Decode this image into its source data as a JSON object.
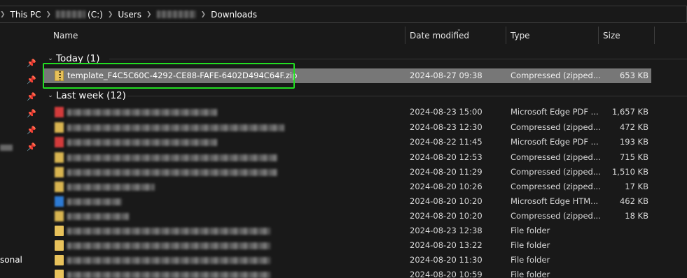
{
  "breadcrumb": {
    "items": [
      {
        "label": "This PC",
        "blurred": false
      },
      {
        "label": "(C:)",
        "blurred": true
      },
      {
        "label": "Users",
        "blurred": false
      },
      {
        "label": "",
        "blurred": true
      },
      {
        "label": "Downloads",
        "blurred": false
      }
    ]
  },
  "sidebar": {
    "partial_label": "sonal"
  },
  "columns": {
    "name": "Name",
    "date": "Date modified",
    "type": "Type",
    "size": "Size"
  },
  "groups": [
    {
      "label": "Today (1)",
      "rows": [
        {
          "name": "template_F4C5C60C-4292-CE88-FAFE-6402D494C64F.zip",
          "date": "2024-08-27 09:38",
          "type": "Compressed (zipped...",
          "size": "653 KB",
          "icon": "zip-icon",
          "selected": true,
          "blurred": false
        }
      ]
    },
    {
      "label": "Last week (12)",
      "rows": [
        {
          "name": "",
          "date": "2024-08-23 15:00",
          "type": "Microsoft Edge PDF ...",
          "size": "1,657 KB",
          "icon": "pdf-icon",
          "blurred": true
        },
        {
          "name": "",
          "date": "2024-08-23 12:30",
          "type": "Compressed (zipped...",
          "size": "472 KB",
          "icon": "zip-icon",
          "blurred": true
        },
        {
          "name": "",
          "date": "2024-08-22 11:45",
          "type": "Microsoft Edge PDF ...",
          "size": "193 KB",
          "icon": "pdf-icon",
          "blurred": true
        },
        {
          "name": "",
          "date": "2024-08-20 12:53",
          "type": "Compressed (zipped...",
          "size": "715 KB",
          "icon": "zip-icon",
          "blurred": true
        },
        {
          "name": "",
          "date": "2024-08-20 11:29",
          "type": "Compressed (zipped...",
          "size": "1,510 KB",
          "icon": "zip-icon",
          "blurred": true
        },
        {
          "name": "",
          "date": "2024-08-20 10:26",
          "type": "Compressed (zipped...",
          "size": "17 KB",
          "icon": "zip-icon",
          "blurred": true
        },
        {
          "name": "",
          "date": "2024-08-20 10:20",
          "type": "Microsoft Edge HTM...",
          "size": "462 KB",
          "icon": "html-icon",
          "blurred": true
        },
        {
          "name": "",
          "date": "2024-08-20 10:20",
          "type": "Compressed (zipped...",
          "size": "18 KB",
          "icon": "zip-icon",
          "blurred": true
        },
        {
          "name": "",
          "date": "2024-08-23 12:38",
          "type": "File folder",
          "size": "",
          "icon": "folder-icon",
          "blurred": true
        },
        {
          "name": "",
          "date": "2024-08-20 13:22",
          "type": "File folder",
          "size": "",
          "icon": "folder-icon",
          "blurred": true
        },
        {
          "name": "",
          "date": "2024-08-20 11:30",
          "type": "File folder",
          "size": "",
          "icon": "folder-icon",
          "blurred": true
        },
        {
          "name": "",
          "date": "2024-08-20 10:59",
          "type": "File folder",
          "size": "",
          "icon": "folder-icon",
          "blurred": true
        }
      ]
    }
  ]
}
